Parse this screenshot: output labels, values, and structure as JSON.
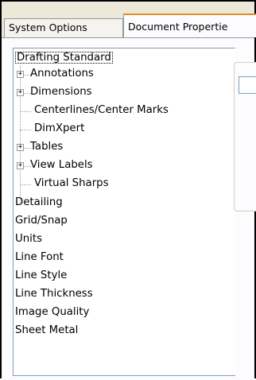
{
  "tabs": {
    "system_options": "System Options",
    "document_properties": "Document Propertie"
  },
  "tree": {
    "root": "Drafting Standard",
    "children": [
      {
        "label": "Annotations",
        "expander": "+"
      },
      {
        "label": "Dimensions",
        "expander": "+"
      },
      {
        "label": "Centerlines/Center Marks",
        "expander": ""
      },
      {
        "label": "DimXpert",
        "expander": ""
      },
      {
        "label": "Tables",
        "expander": "+"
      },
      {
        "label": "View Labels",
        "expander": "+"
      },
      {
        "label": "Virtual Sharps",
        "expander": ""
      }
    ],
    "top_items": [
      "Detailing",
      "Grid/Snap",
      "Units",
      "Line Font",
      "Line Style",
      "Line Thickness",
      "Image Quality",
      "Sheet Metal"
    ]
  }
}
